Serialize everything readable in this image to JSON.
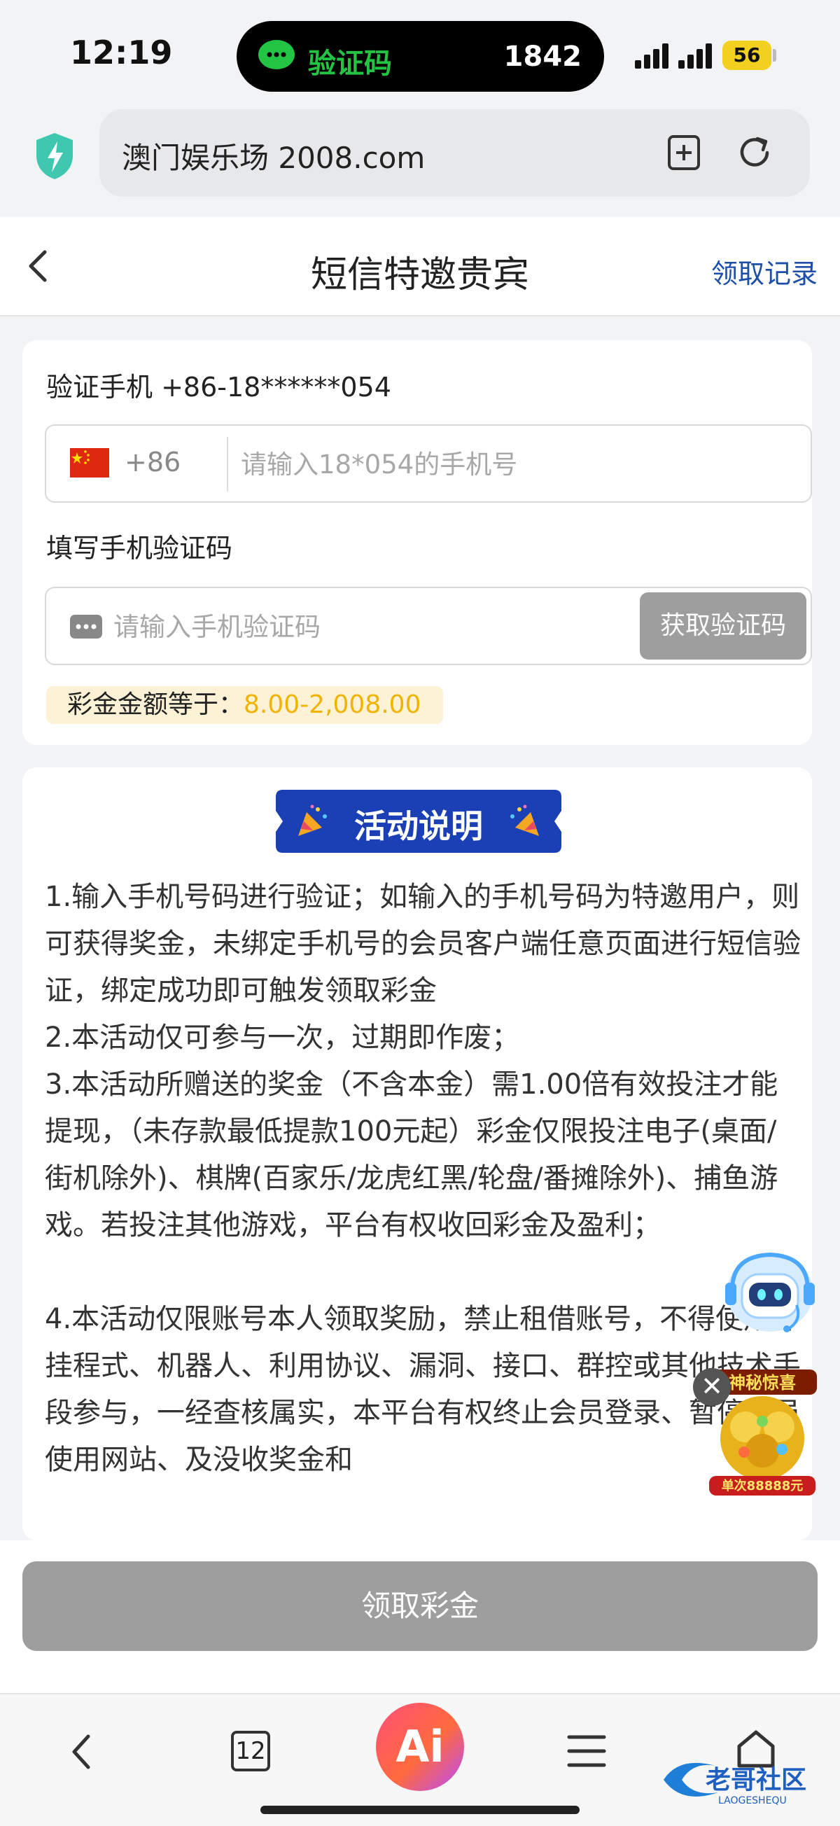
{
  "status_bar": {
    "time": "12:19",
    "island_label": "验证码",
    "island_code": "1842",
    "battery": "56"
  },
  "address_bar": {
    "url": "澳门娱乐场 2008.com"
  },
  "header": {
    "title": "短信特邀贵宾",
    "records_link": "领取记录"
  },
  "verify": {
    "phone_label": "验证手机 +86-18******054",
    "country_code": "+86",
    "phone_placeholder": "请输入18*054的手机号",
    "code_label": "填写手机验证码",
    "code_placeholder": "请输入手机验证码",
    "get_code_button": "获取验证码",
    "bonus_label": "彩金金额等于：",
    "bonus_value": "8.00-2,008.00"
  },
  "info": {
    "banner_title": "活动说明",
    "rules": [
      "1.输入手机号码进行验证；如输入的手机号码为特邀用户，则可获得奖金，未绑定手机号的会员客户端任意页面进行短信验证，绑定成功即可触发领取彩金",
      "2.本活动仅可参与一次，过期即作废；",
      "3.本活动所赠送的奖金（不含本金）需1.00倍有效投注才能提现，（未存款最低提款100元起）彩金仅限投注电子(桌面/街机除外)、棋牌(百家乐/龙虎红黑/轮盘/番摊除外)、捕鱼游戏。若投注其他游戏，平台有权收回彩金及盈利；",
      "4.本活动仅限账号本人领取奖励，禁止租借账号，不得使用外挂程式、机器人、利用协议、漏洞、接口、群控或其他技术手段参与，一经查核属实，本平台有权终止会员登录、暂停会员使用网站、及没收奖金和"
    ]
  },
  "floating": {
    "gift_title": "神秘惊喜",
    "gift_sub": "单次88888元"
  },
  "claim": {
    "button": "领取彩金"
  },
  "nav": {
    "tab_count": "12",
    "ai_label": "Ai",
    "watermark": "老哥社区",
    "watermark_sub": "LAOGESHEQU"
  },
  "colors": {
    "accent_blue": "#1d4fa8",
    "bonus_gold": "#f0b400",
    "disabled_gray": "#9e9e9e",
    "wechat_green": "#23c343"
  }
}
